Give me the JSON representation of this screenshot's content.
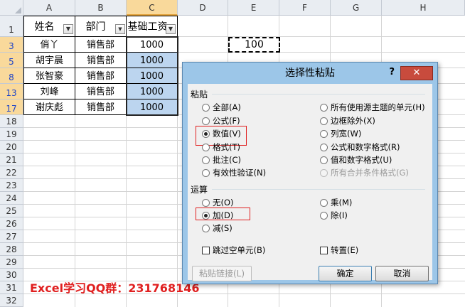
{
  "sheet": {
    "columns": [
      "A",
      "B",
      "C",
      "D",
      "E",
      "F",
      "G",
      "H"
    ],
    "rows": [
      "1",
      "3",
      "5",
      "8",
      "13",
      "17",
      "18",
      "19",
      "20",
      "21",
      "22",
      "23",
      "24",
      "25",
      "26",
      "27",
      "28",
      "29",
      "30",
      "31",
      "32"
    ],
    "header": {
      "name": "姓名",
      "dept": "部门",
      "salary": "基础工资"
    },
    "data": [
      {
        "name": "俏丫",
        "dept": "销售部",
        "salary": "1000"
      },
      {
        "name": "胡宇晨",
        "dept": "销售部",
        "salary": "1000"
      },
      {
        "name": "张智豪",
        "dept": "销售部",
        "salary": "1000"
      },
      {
        "name": "刘峰",
        "dept": "销售部",
        "salary": "1000"
      },
      {
        "name": "谢庆彪",
        "dept": "销售部",
        "salary": "1000"
      }
    ],
    "copied_value": "100",
    "filter_icon": "filter-dropdown-icon"
  },
  "dialog": {
    "title": "选择性粘贴",
    "help": "?",
    "close": "✕",
    "paste_section": "粘贴",
    "paste_options_left": [
      {
        "label": "全部(A)",
        "checked": false
      },
      {
        "label": "公式(F)",
        "checked": false
      },
      {
        "label": "数值(V)",
        "checked": true
      },
      {
        "label": "格式(T)",
        "checked": false
      },
      {
        "label": "批注(C)",
        "checked": false
      },
      {
        "label": "有效性验证(N)",
        "checked": false
      }
    ],
    "paste_options_right": [
      {
        "label": "所有使用源主题的单元(H)",
        "checked": false,
        "disabled": false
      },
      {
        "label": "边框除外(X)",
        "checked": false,
        "disabled": false
      },
      {
        "label": "列宽(W)",
        "checked": false,
        "disabled": false
      },
      {
        "label": "公式和数字格式(R)",
        "checked": false,
        "disabled": false
      },
      {
        "label": "值和数字格式(U)",
        "checked": false,
        "disabled": false
      },
      {
        "label": "所有合并条件格式(G)",
        "checked": false,
        "disabled": true
      }
    ],
    "operation_section": "运算",
    "operation_left": [
      {
        "label": "无(O)",
        "checked": false
      },
      {
        "label": "加(D)",
        "checked": true
      },
      {
        "label": "减(S)",
        "checked": false
      }
    ],
    "operation_right": [
      {
        "label": "乘(M)",
        "checked": false
      },
      {
        "label": "除(I)",
        "checked": false
      }
    ],
    "skip_blanks": "跳过空单元(B)",
    "transpose": "转置(E)",
    "paste_link": "粘贴链接(L)",
    "ok": "确定",
    "cancel": "取消"
  },
  "watermark": "Excel学习QQ群：231768146",
  "colors": {
    "highlight": "#e02020",
    "selection": "#bcd5ef",
    "dialog_frame": "#9cc6e8"
  }
}
